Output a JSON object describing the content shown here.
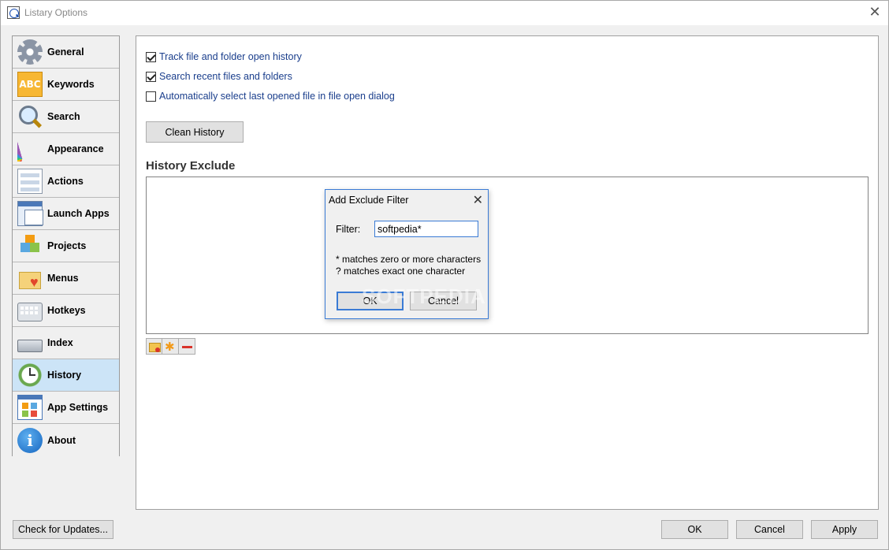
{
  "window": {
    "title": "Listary Options",
    "app_icon": "listary-app-icon",
    "close_glyph": "✕"
  },
  "sidebar": {
    "items": [
      {
        "label": "General",
        "icon": "gear-icon"
      },
      {
        "label": "Keywords",
        "icon": "abc-icon"
      },
      {
        "label": "Search",
        "icon": "magnifier-icon"
      },
      {
        "label": "Appearance",
        "icon": "color-swatch-icon"
      },
      {
        "label": "Actions",
        "icon": "menu-list-icon"
      },
      {
        "label": "Launch Apps",
        "icon": "app-windows-icon"
      },
      {
        "label": "Projects",
        "icon": "cubes-icon"
      },
      {
        "label": "Menus",
        "icon": "folder-heart-icon"
      },
      {
        "label": "Hotkeys",
        "icon": "keyboard-icon"
      },
      {
        "label": "Index",
        "icon": "drive-icon"
      },
      {
        "label": "History",
        "icon": "clock-icon",
        "active": true
      },
      {
        "label": "App Settings",
        "icon": "app-grid-icon"
      },
      {
        "label": "About",
        "icon": "info-icon"
      }
    ]
  },
  "history": {
    "checkboxes": [
      {
        "label": "Track file and folder open history",
        "checked": true
      },
      {
        "label": "Search recent files and folders",
        "checked": true
      },
      {
        "label": "Automatically select last opened file in file open dialog",
        "checked": false
      }
    ],
    "clean_button": "Clean History",
    "exclude_title": "History Exclude",
    "list_buttons": [
      "add-folder-exclude-icon",
      "add-wildcard-filter-icon",
      "remove-icon"
    ]
  },
  "dialog": {
    "title": "Add Exclude Filter",
    "close_glyph": "✕",
    "filter_label": "Filter:",
    "filter_value": "softpedia*",
    "hint_1": "* matches zero or more characters",
    "hint_2": "? matches exact one character",
    "ok_label": "OK",
    "cancel_label": "Cancel"
  },
  "footer": {
    "check_updates": "Check for Updates...",
    "ok": "OK",
    "cancel": "Cancel",
    "apply": "Apply"
  },
  "watermark": "SOFTPEDIA",
  "colors": {
    "accent_blue": "#3a7bd5",
    "active_nav": "#cce4f7",
    "checkbox_label": "#1a3e8c"
  }
}
